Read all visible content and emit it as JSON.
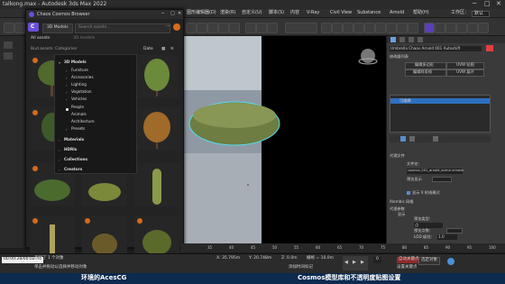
{
  "window": {
    "title": "talkong.max - Autodesk 3ds Max 2022"
  },
  "menu": {
    "items": [
      "图形编辑器(D)",
      "渲染(R)",
      "自定义(U)",
      "脚本(S)",
      "内容",
      "V-Ray",
      "Civil View",
      "Substance",
      "Arnold",
      "帮助(H)"
    ],
    "workspace_label": "工作区：",
    "workspace_value": "默认"
  },
  "cosmos": {
    "title": "Chaos Cosmos Browser",
    "logo": "C",
    "dropdown_value": "3D Models",
    "search_placeholder": "Search assets...",
    "tabs": [
      "All assets",
      "3D Models"
    ],
    "subtabs": [
      "Ratings",
      "3D models"
    ],
    "side_labels": [
      "Bud assets",
      "Categories"
    ],
    "sort_label": "Date",
    "categories": [
      "3D Models",
      "Furniture",
      "Accessories",
      "Lighting",
      "Vegetation",
      "Vehicles",
      "People",
      "Animals",
      "Architecture",
      "Presets"
    ],
    "groups": [
      "Materials",
      "HDRIs",
      "Collections",
      "Creators"
    ]
  },
  "right_panel": {
    "object_name": "Umbrella Chaos Arnold 001 Autoshift",
    "section_modifier_list": "修改器列表",
    "buttons": [
      "编辑多边形",
      "UVW 贴图",
      "编辑样条线",
      "UVW 展开"
    ],
    "stack_item": "可编辑",
    "rollout_params": "参数",
    "rollout_map": "代理文件",
    "file_label": "文件名：",
    "file_value": "cosmos_001_arnold_scene.vrmesh",
    "preview_label": "预览显示",
    "checkbox_label": "显示 X 射线模式",
    "rollout_vray": "Alembic 网格",
    "rollout_display": "代理参数",
    "display_label": "显示",
    "display_type_label": "预览类型：",
    "display_type_value": "点",
    "line_label": "预览点数：",
    "lod_label": "LOD 级别：",
    "lod_value": "1.0"
  },
  "timeline": {
    "ticks": [
      "35",
      "40",
      "45",
      "50",
      "55",
      "60",
      "65",
      "70",
      "75",
      "80",
      "85",
      "90",
      "95",
      "100"
    ]
  },
  "status": {
    "time_display": "00:00:28/00:02:44",
    "selected": "选择了 1 个对象",
    "prompt": "单击并拖动以选择并移动对象",
    "x_label": "X: 35.795m",
    "y_label": "Y: 20.748m",
    "z_label": "Z: 0.0m",
    "grid": "栅格 = 10.0m",
    "add_time_tag": "添加时间标记",
    "auto_key": "自动关键点",
    "set_key": "设置关键点",
    "filter": "选定对象",
    "frame": "0"
  },
  "caption": {
    "left": "环境的AcesCG",
    "right": "Cosmos模型库和不透明度贴图设置"
  },
  "colors": {
    "accent": "#6b4fd8",
    "orange_badge": "#d66a1c",
    "caption_bg": "#0d2a4f",
    "selection_blue": "#2e6fbf"
  }
}
